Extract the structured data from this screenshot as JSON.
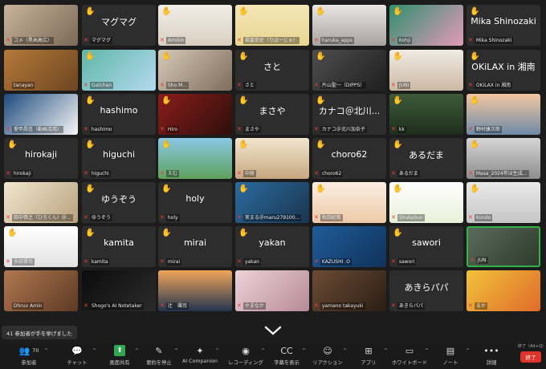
{
  "colors": {
    "hand": "#f5b33d",
    "muted_mic": "#e0433c",
    "active_border": "#34b24a",
    "end": "#e0332c"
  },
  "participants": [
    {
      "label": "コメ（黒米高広）",
      "big": "",
      "hand": false,
      "active": false
    },
    {
      "label": "マグマグ",
      "big": "マグマグ",
      "hand": true,
      "active": false
    },
    {
      "label": "Amikin",
      "big": "",
      "hand": true,
      "active": false
    },
    {
      "label": "福冨崇史（りばーじゅ）",
      "big": "",
      "hand": true,
      "active": false
    },
    {
      "label": "haruka_apps",
      "big": "",
      "hand": true,
      "active": false
    },
    {
      "label": "Kohji",
      "big": "",
      "hand": true,
      "active": false
    },
    {
      "label": "Mika Shinozaki",
      "big": "Mika Shinozaki",
      "hand": true,
      "active": false
    },
    {
      "label": "tanayan",
      "big": "",
      "hand": false,
      "active": false
    },
    {
      "label": "Gatchan",
      "big": "",
      "hand": true,
      "active": false
    },
    {
      "label": "Sho M...",
      "big": "",
      "hand": true,
      "active": false
    },
    {
      "label": "さと",
      "big": "さと",
      "hand": true,
      "active": false
    },
    {
      "label": "片山聖一（DIPPS）",
      "big": "",
      "hand": true,
      "active": false
    },
    {
      "label": "JUNI",
      "big": "",
      "hand": true,
      "active": false
    },
    {
      "label": "OKiLAX in 湘南",
      "big": "OKiLAX in 湘南",
      "hand": true,
      "active": false
    },
    {
      "label": "愛甲昌信（動画活用）",
      "big": "",
      "hand": false,
      "active": false
    },
    {
      "label": "hashimo",
      "big": "hashimo",
      "hand": true,
      "active": false
    },
    {
      "label": "Hiro",
      "big": "",
      "hand": true,
      "active": false
    },
    {
      "label": "まさや",
      "big": "まさや",
      "hand": true,
      "active": false
    },
    {
      "label": "カナコ＠北川加奈子",
      "big": "カナコ＠北川...",
      "hand": true,
      "active": false
    },
    {
      "label": "kk",
      "big": "",
      "hand": true,
      "active": false
    },
    {
      "label": "野村康次郎",
      "big": "",
      "hand": true,
      "active": false
    },
    {
      "label": "hirokaji",
      "big": "hirokaji",
      "hand": true,
      "active": false
    },
    {
      "label": "higuchi",
      "big": "higuchi",
      "hand": true,
      "active": false
    },
    {
      "label": "えむ",
      "big": "",
      "hand": true,
      "active": false
    },
    {
      "label": "中原",
      "big": "",
      "hand": true,
      "active": false
    },
    {
      "label": "choro62",
      "big": "choro62",
      "hand": true,
      "active": false
    },
    {
      "label": "あるだま",
      "big": "あるだま",
      "hand": true,
      "active": false
    },
    {
      "label": "Masa_2024年は生成...",
      "big": "",
      "hand": true,
      "active": false
    },
    {
      "label": "田中啓之（ひろくん）＠...",
      "big": "",
      "hand": false,
      "active": false
    },
    {
      "label": "ゆうぞう",
      "big": "ゆうぞう",
      "hand": true,
      "active": false
    },
    {
      "label": "holy",
      "big": "holy",
      "hand": true,
      "active": false
    },
    {
      "label": "実まる＠maru279100...",
      "big": "",
      "hand": true,
      "active": false
    },
    {
      "label": "秋田紀衛",
      "big": "",
      "hand": true,
      "active": false
    },
    {
      "label": "ShukaSun",
      "big": "",
      "hand": true,
      "active": false
    },
    {
      "label": "Kondo",
      "big": "",
      "hand": true,
      "active": false
    },
    {
      "label": "多田賢司",
      "big": "",
      "hand": true,
      "active": false
    },
    {
      "label": "kamita",
      "big": "kamita",
      "hand": true,
      "active": false
    },
    {
      "label": "mirai",
      "big": "mirai",
      "hand": true,
      "active": false
    },
    {
      "label": "yakan",
      "big": "yakan",
      "hand": true,
      "active": false
    },
    {
      "label": "KAZUSHI .O",
      "big": "",
      "hand": false,
      "active": false
    },
    {
      "label": "sawori",
      "big": "sawori",
      "hand": true,
      "active": false
    },
    {
      "label": "JUN",
      "big": "",
      "hand": false,
      "active": true
    },
    {
      "label": "Dhruv Amin",
      "big": "",
      "hand": false,
      "active": false
    },
    {
      "label": "Shogo's AI Notetaker",
      "big": "",
      "hand": false,
      "active": false
    },
    {
      "label": "辻　颯司",
      "big": "",
      "hand": false,
      "active": false
    },
    {
      "label": "やまなか",
      "big": "",
      "hand": false,
      "active": false
    },
    {
      "label": "yamano takayuki",
      "big": "",
      "hand": false,
      "active": false
    },
    {
      "label": "あきらパパ",
      "big": "あきらパパ",
      "hand": false,
      "active": false
    },
    {
      "label": "るか",
      "big": "",
      "hand": false,
      "active": false
    }
  ],
  "toast": "41 参加者が手を挙げました",
  "toolbar": {
    "participants_count": "70",
    "items": [
      {
        "label": "参加者",
        "icon": "participants-icon"
      },
      {
        "label": "チャット",
        "icon": "chat-icon"
      },
      {
        "label": "画面共有",
        "icon": "share-screen-icon"
      },
      {
        "label": "要約を停止",
        "icon": "summary-icon"
      },
      {
        "label": "AI Companion",
        "icon": "ai-companion-icon"
      },
      {
        "label": "レコーディング",
        "icon": "record-icon"
      },
      {
        "label": "字幕を表示",
        "icon": "captions-icon"
      },
      {
        "label": "リアクション",
        "icon": "reaction-icon"
      },
      {
        "label": "アプリ",
        "icon": "apps-icon"
      },
      {
        "label": "ホワイトボード",
        "icon": "whiteboard-icon"
      },
      {
        "label": "ノート",
        "icon": "notes-icon"
      },
      {
        "label": "詳細",
        "icon": "more-icon"
      }
    ],
    "end_label": "終了",
    "end_tooltip": "終了（Alt+Q）"
  }
}
